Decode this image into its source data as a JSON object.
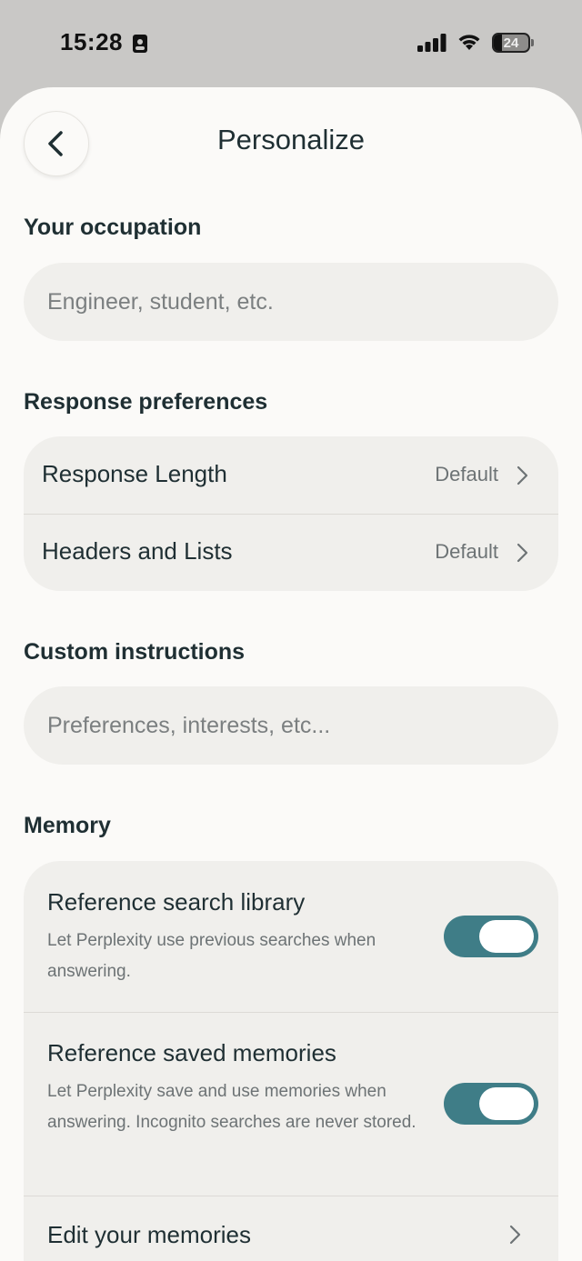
{
  "status_bar": {
    "time": "15:28",
    "battery": "24",
    "battery_level": 0.24
  },
  "header": {
    "title": "Personalize"
  },
  "occupation": {
    "section_title": "Your occupation",
    "value": "",
    "placeholder": "Engineer, student, etc."
  },
  "response_preferences": {
    "section_title": "Response preferences",
    "rows": [
      {
        "label": "Response Length",
        "value": "Default"
      },
      {
        "label": "Headers and Lists",
        "value": "Default"
      }
    ]
  },
  "custom_instructions": {
    "section_title": "Custom instructions",
    "value": "",
    "placeholder": "Preferences, interests, etc..."
  },
  "memory": {
    "section_title": "Memory",
    "reference_search_library": {
      "label": "Reference search library",
      "description": "Let Perplexity use previous searches when answering.",
      "enabled": true
    },
    "reference_saved_memories": {
      "label": "Reference saved memories",
      "description": "Let Perplexity save and use memories when answering. Incognito searches are never stored.",
      "enabled": true
    },
    "edit_memories": {
      "label": "Edit your memories"
    }
  },
  "colors": {
    "accent": "#3f7d87",
    "background": "#fbfaf8",
    "surface": "#f0efec",
    "text": "#1f2f33",
    "muted": "#6d7375"
  }
}
